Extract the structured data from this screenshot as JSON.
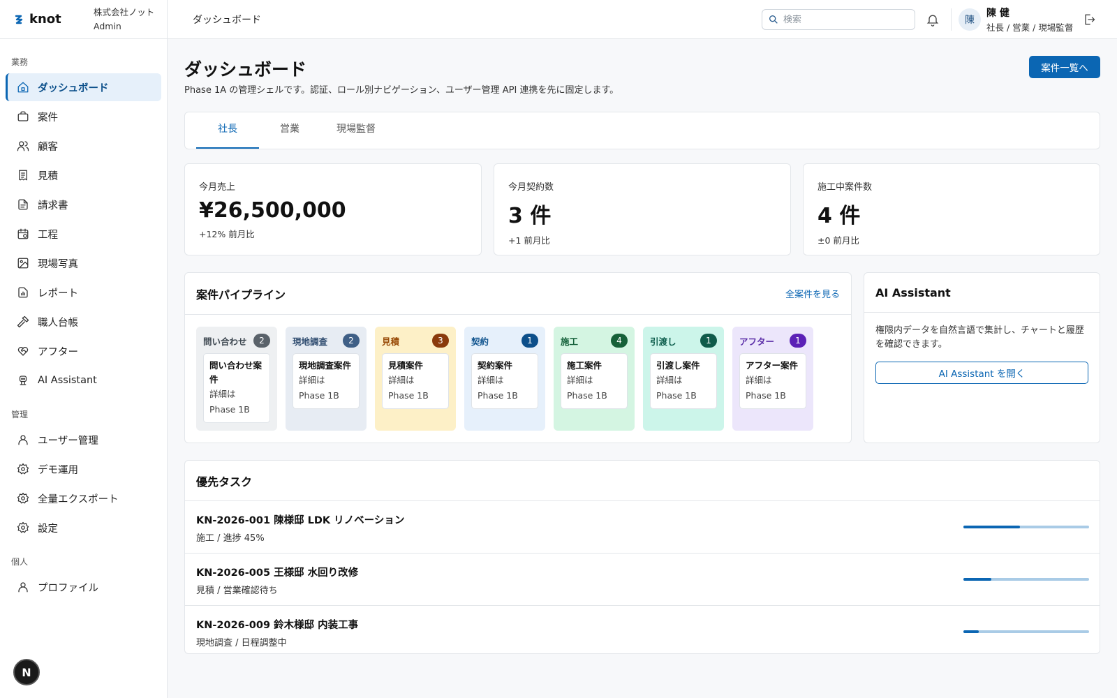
{
  "brand": {
    "name": "knot",
    "org": "株式会社ノット",
    "role": "Admin"
  },
  "sidebar": {
    "sections": [
      {
        "label": "業務"
      },
      {
        "label": "管理"
      },
      {
        "label": "個人"
      }
    ],
    "items": [
      {
        "label": "ダッシュボード",
        "icon": "home-icon"
      },
      {
        "label": "案件",
        "icon": "briefcase-icon"
      },
      {
        "label": "顧客",
        "icon": "users-icon"
      },
      {
        "label": "見積",
        "icon": "receipt-icon"
      },
      {
        "label": "請求書",
        "icon": "invoice-icon"
      },
      {
        "label": "工程",
        "icon": "calendar-icon"
      },
      {
        "label": "現場写真",
        "icon": "image-icon"
      },
      {
        "label": "レポート",
        "icon": "report-icon"
      },
      {
        "label": "職人台帳",
        "icon": "hammer-icon"
      },
      {
        "label": "アフター",
        "icon": "heart-handshake-icon"
      },
      {
        "label": "AI Assistant",
        "icon": "bot-icon"
      },
      {
        "label": "ユーザー管理",
        "icon": "user-icon"
      },
      {
        "label": "デモ運用",
        "icon": "gear-icon"
      },
      {
        "label": "全量エクスポート",
        "icon": "gear-icon"
      },
      {
        "label": "設定",
        "icon": "gear-icon"
      },
      {
        "label": "プロファイル",
        "icon": "user-icon"
      }
    ],
    "next_badge": "N"
  },
  "topbar": {
    "title": "ダッシュボード",
    "search_placeholder": "検索",
    "user": {
      "initial": "陳",
      "name": "陳 健",
      "roles": "社長 / 営業 / 現場監督"
    }
  },
  "page": {
    "title": "ダッシュボード",
    "description": "Phase 1A の管理シェルです。認証、ロール別ナビゲーション、ユーザー管理 API 連携を先に固定します。",
    "primary_button": "案件一覧へ"
  },
  "tabs": [
    {
      "label": "社長",
      "active": true
    },
    {
      "label": "営業",
      "active": false
    },
    {
      "label": "現場監督",
      "active": false
    }
  ],
  "kpis": [
    {
      "label": "今月売上",
      "value": "¥26,500,000",
      "delta": "+12% 前月比"
    },
    {
      "label": "今月契約数",
      "value": "3 件",
      "delta": "+1 前月比"
    },
    {
      "label": "施工中案件数",
      "value": "4 件",
      "delta": "±0 前月比"
    }
  ],
  "pipeline": {
    "title": "案件パイプライン",
    "link": "全案件を見る",
    "lanes": [
      {
        "title": "問い合わせ",
        "count": "2",
        "card_title": "問い合わせ案件",
        "card_sub": "詳細は Phase 1B",
        "bg": "#eef0f2",
        "fg": "#3d4750",
        "badge": "#5a626a"
      },
      {
        "title": "現地調査",
        "count": "2",
        "card_title": "現地調査案件",
        "card_sub": "詳細は Phase 1B",
        "bg": "#e7ecf3",
        "fg": "#2d4a6e",
        "badge": "#3f5f86"
      },
      {
        "title": "見積",
        "count": "3",
        "card_title": "見積案件",
        "card_sub": "詳細は Phase 1B",
        "bg": "#fdf0c7",
        "fg": "#9a4d0a",
        "badge": "#8a3a0c"
      },
      {
        "title": "契約",
        "count": "1",
        "card_title": "契約案件",
        "card_sub": "詳細は Phase 1B",
        "bg": "#e6f0fb",
        "fg": "#12558f",
        "badge": "#0d4f8a"
      },
      {
        "title": "施工",
        "count": "4",
        "card_title": "施工案件",
        "card_sub": "詳細は Phase 1B",
        "bg": "#d4f5e2",
        "fg": "#14603a",
        "badge": "#166038"
      },
      {
        "title": "引渡し",
        "count": "1",
        "card_title": "引渡し案件",
        "card_sub": "詳細は Phase 1B",
        "bg": "#ccf5ea",
        "fg": "#0c5d4c",
        "badge": "#0f5b4a"
      },
      {
        "title": "アフター",
        "count": "1",
        "card_title": "アフター案件",
        "card_sub": "詳細は Phase 1B",
        "bg": "#ece6fb",
        "fg": "#5b2ea8",
        "badge": "#5b21b6"
      }
    ]
  },
  "ai_assistant": {
    "title": "AI Assistant",
    "description": "権限内データを自然言語で集計し、チャートと履歴を確認できます。",
    "button": "AI Assistant を開く"
  },
  "tasks": {
    "title": "優先タスク",
    "items": [
      {
        "title": "KN-2026-001 陳様邸 LDK リノベーション",
        "sub": "施工 / 進捗 45%",
        "progress": 0.45
      },
      {
        "title": "KN-2026-005 王様邸 水回り改修",
        "sub": "見積 / 営業確認待ち",
        "progress": 0.22
      },
      {
        "title": "KN-2026-009 鈴木様邸 内装工事",
        "sub": "現地調査 / 日程調整中",
        "progress": 0.12
      }
    ]
  },
  "colors": {
    "accent": "#0b66b3",
    "accent_light": "#e6f0fa",
    "progress_track": "#a9cbe6"
  }
}
